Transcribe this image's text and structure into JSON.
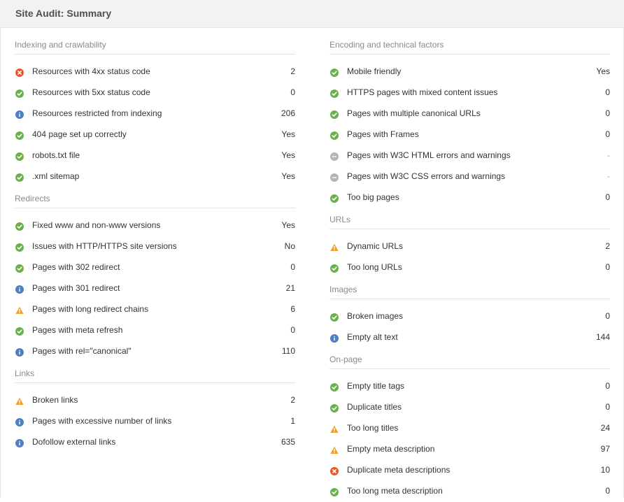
{
  "header": {
    "title": "Site Audit: Summary"
  },
  "colors": {
    "ok": "#6ab04c",
    "error": "#e8572a",
    "warning": "#f39c2e",
    "info": "#4f7fc0",
    "neutral": "#b5b5b5"
  },
  "left": [
    {
      "title": "Indexing and crawlability",
      "items": [
        {
          "status": "error",
          "icon": "error-x-icon",
          "label": "Resources with 4xx status code",
          "value": "2"
        },
        {
          "status": "ok",
          "icon": "check-icon",
          "label": "Resources with 5xx status code",
          "value": "0"
        },
        {
          "status": "info",
          "icon": "info-icon",
          "label": "Resources restricted from indexing",
          "value": "206"
        },
        {
          "status": "ok",
          "icon": "check-icon",
          "label": "404 page set up correctly",
          "value": "Yes"
        },
        {
          "status": "ok",
          "icon": "check-icon",
          "label": "robots.txt file",
          "value": "Yes"
        },
        {
          "status": "ok",
          "icon": "check-icon",
          "label": ".xml sitemap",
          "value": "Yes"
        }
      ]
    },
    {
      "title": "Redirects",
      "items": [
        {
          "status": "ok",
          "icon": "check-icon",
          "label": "Fixed www and non-www versions",
          "value": "Yes"
        },
        {
          "status": "ok",
          "icon": "check-icon",
          "label": "Issues with HTTP/HTTPS site versions",
          "value": "No"
        },
        {
          "status": "ok",
          "icon": "check-icon",
          "label": "Pages with 302 redirect",
          "value": "0"
        },
        {
          "status": "info",
          "icon": "info-icon",
          "label": "Pages with 301 redirect",
          "value": "21"
        },
        {
          "status": "warning",
          "icon": "warning-icon",
          "label": "Pages with long redirect chains",
          "value": "6"
        },
        {
          "status": "ok",
          "icon": "check-icon",
          "label": "Pages with meta refresh",
          "value": "0"
        },
        {
          "status": "info",
          "icon": "info-icon",
          "label": "Pages with rel=\"canonical\"",
          "value": "110"
        }
      ]
    },
    {
      "title": "Links",
      "items": [
        {
          "status": "warning",
          "icon": "warning-icon",
          "label": "Broken links",
          "value": "2"
        },
        {
          "status": "info",
          "icon": "info-icon",
          "label": "Pages with excessive number of links",
          "value": "1"
        },
        {
          "status": "info",
          "icon": "info-icon",
          "label": "Dofollow external links",
          "value": "635"
        }
      ]
    }
  ],
  "right": [
    {
      "title": "Encoding and technical factors",
      "items": [
        {
          "status": "ok",
          "icon": "check-icon",
          "label": "Mobile friendly",
          "value": "Yes"
        },
        {
          "status": "ok",
          "icon": "check-icon",
          "label": "HTTPS pages with mixed content issues",
          "value": "0"
        },
        {
          "status": "ok",
          "icon": "check-icon",
          "label": "Pages with multiple canonical URLs",
          "value": "0"
        },
        {
          "status": "ok",
          "icon": "check-icon",
          "label": "Pages with Frames",
          "value": "0"
        },
        {
          "status": "neutral",
          "icon": "minus-icon",
          "label": "Pages with W3C HTML errors and warnings",
          "value": "-"
        },
        {
          "status": "neutral",
          "icon": "minus-icon",
          "label": "Pages with W3C CSS errors and warnings",
          "value": "-"
        },
        {
          "status": "ok",
          "icon": "check-icon",
          "label": "Too big pages",
          "value": "0"
        }
      ]
    },
    {
      "title": "URLs",
      "items": [
        {
          "status": "warning",
          "icon": "warning-icon",
          "label": "Dynamic URLs",
          "value": "2"
        },
        {
          "status": "ok",
          "icon": "check-icon",
          "label": "Too long URLs",
          "value": "0"
        }
      ]
    },
    {
      "title": "Images",
      "items": [
        {
          "status": "ok",
          "icon": "check-icon",
          "label": "Broken images",
          "value": "0"
        },
        {
          "status": "info",
          "icon": "info-icon",
          "label": "Empty alt text",
          "value": "144"
        }
      ]
    },
    {
      "title": "On-page",
      "items": [
        {
          "status": "ok",
          "icon": "check-icon",
          "label": "Empty title tags",
          "value": "0"
        },
        {
          "status": "ok",
          "icon": "check-icon",
          "label": "Duplicate titles",
          "value": "0"
        },
        {
          "status": "warning",
          "icon": "warning-icon",
          "label": "Too long titles",
          "value": "24"
        },
        {
          "status": "warning",
          "icon": "warning-icon",
          "label": "Empty meta description",
          "value": "97"
        },
        {
          "status": "error",
          "icon": "error-x-icon",
          "label": "Duplicate meta descriptions",
          "value": "10"
        },
        {
          "status": "ok",
          "icon": "check-icon",
          "label": "Too long meta description",
          "value": "0"
        }
      ]
    }
  ]
}
